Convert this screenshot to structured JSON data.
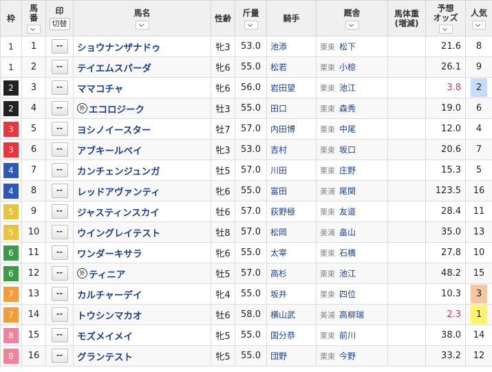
{
  "headers": {
    "waku": "枠",
    "umaban_l1": "馬",
    "umaban_l2": "番",
    "mark": "印",
    "mark_toggle": "切替",
    "name": "馬名",
    "sexage": "性齢",
    "weight": "斤量",
    "jockey": "騎手",
    "stable": "厩舎",
    "body_l1": "馬体重",
    "body_l2": "(増減)",
    "odds_l1": "予想",
    "odds_l2": "オッズ",
    "pop": "人気"
  },
  "colors": {
    "waku_bg": [
      "#ffffff",
      "#ffffff",
      "#222222",
      "#222222",
      "#e8373c",
      "#e8373c",
      "#2f57b6",
      "#2f57b6",
      "#e8c43a",
      "#e8c43a",
      "#3c9b48",
      "#3c9b48",
      "#f29d39",
      "#f29d39",
      "#f0839b",
      "#f0839b"
    ],
    "waku_fg": [
      "#222222",
      "#222222",
      "#ffffff",
      "#ffffff",
      "#ffffff",
      "#ffffff",
      "#ffffff",
      "#ffffff",
      "#ffffff",
      "#ffffff",
      "#ffffff",
      "#ffffff",
      "#ffffff",
      "#ffffff",
      "#ffffff",
      "#ffffff"
    ],
    "pop1": "#fff36b",
    "pop2": "#c5dcfa",
    "pop3": "#f4c7a2"
  },
  "rows": [
    {
      "waku": "1",
      "num": "1",
      "mark": "--",
      "foreign": "",
      "name": "ショウナンザナドゥ",
      "sexage": "牝3",
      "weight": "53.0",
      "jockey": "池添",
      "region": "栗東",
      "trainer": "松下",
      "odds": "21.6",
      "pop": "8"
    },
    {
      "waku": "1",
      "num": "2",
      "mark": "--",
      "foreign": "",
      "name": "テイエムスパーダ",
      "sexage": "牝6",
      "weight": "55.0",
      "jockey": "松若",
      "region": "栗東",
      "trainer": "小椋",
      "odds": "26.1",
      "pop": "9"
    },
    {
      "waku": "2",
      "num": "3",
      "mark": "--",
      "foreign": "",
      "name": "ママコチャ",
      "sexage": "牝6",
      "weight": "56.0",
      "jockey": "岩田望",
      "region": "栗東",
      "trainer": "池江",
      "odds": "3.8",
      "pop": "2"
    },
    {
      "waku": "2",
      "num": "4",
      "mark": "--",
      "foreign": "外",
      "name": "エコロジーク",
      "sexage": "牡3",
      "weight": "55.0",
      "jockey": "田口",
      "region": "栗東",
      "trainer": "森秀",
      "odds": "19.0",
      "pop": "6"
    },
    {
      "waku": "3",
      "num": "5",
      "mark": "--",
      "foreign": "",
      "name": "ヨシノイースター",
      "sexage": "牡7",
      "weight": "57.0",
      "jockey": "内田博",
      "region": "栗東",
      "trainer": "中尾",
      "odds": "12.0",
      "pop": "4"
    },
    {
      "waku": "3",
      "num": "6",
      "mark": "--",
      "foreign": "",
      "name": "アブキールベイ",
      "sexage": "牝3",
      "weight": "53.0",
      "jockey": "吉村",
      "region": "栗東",
      "trainer": "坂口",
      "odds": "20.6",
      "pop": "7"
    },
    {
      "waku": "4",
      "num": "7",
      "mark": "--",
      "foreign": "",
      "name": "カンチェンジュンガ",
      "sexage": "牡5",
      "weight": "57.0",
      "jockey": "川田",
      "region": "栗東",
      "trainer": "庄野",
      "odds": "15.3",
      "pop": "5"
    },
    {
      "waku": "4",
      "num": "8",
      "mark": "--",
      "foreign": "",
      "name": "レッドアヴァンティ",
      "sexage": "牝6",
      "weight": "55.0",
      "jockey": "富田",
      "region": "美浦",
      "trainer": "尾関",
      "odds": "123.5",
      "pop": "16"
    },
    {
      "waku": "5",
      "num": "9",
      "mark": "--",
      "foreign": "",
      "name": "ジャスティンスカイ",
      "sexage": "牡6",
      "weight": "57.0",
      "jockey": "荻野極",
      "region": "栗東",
      "trainer": "友道",
      "odds": "28.4",
      "pop": "11"
    },
    {
      "waku": "5",
      "num": "10",
      "mark": "--",
      "foreign": "",
      "name": "ウイングレイテスト",
      "sexage": "牡8",
      "weight": "57.0",
      "jockey": "松岡",
      "region": "美浦",
      "trainer": "畠山",
      "odds": "35.0",
      "pop": "13"
    },
    {
      "waku": "6",
      "num": "11",
      "mark": "--",
      "foreign": "",
      "name": "ワンダーキサラ",
      "sexage": "牝6",
      "weight": "55.0",
      "jockey": "太宰",
      "region": "栗東",
      "trainer": "石橋",
      "odds": "27.8",
      "pop": "10"
    },
    {
      "waku": "6",
      "num": "12",
      "mark": "--",
      "foreign": "外",
      "name": "ティニア",
      "sexage": "牡5",
      "weight": "57.0",
      "jockey": "高杉",
      "region": "栗東",
      "trainer": "池江",
      "odds": "48.2",
      "pop": "15"
    },
    {
      "waku": "7",
      "num": "13",
      "mark": "--",
      "foreign": "",
      "name": "カルチャーデイ",
      "sexage": "牝4",
      "weight": "55.0",
      "jockey": "坂井",
      "region": "栗東",
      "trainer": "四位",
      "odds": "10.3",
      "pop": "3"
    },
    {
      "waku": "7",
      "num": "14",
      "mark": "--",
      "foreign": "",
      "name": "トウシンマカオ",
      "sexage": "牡6",
      "weight": "58.0",
      "jockey": "横山武",
      "region": "美浦",
      "trainer": "高柳瑞",
      "odds": "2.3",
      "pop": "1"
    },
    {
      "waku": "8",
      "num": "15",
      "mark": "--",
      "foreign": "",
      "name": "モズメイメイ",
      "sexage": "牝5",
      "weight": "55.0",
      "jockey": "国分恭",
      "region": "栗東",
      "trainer": "前川",
      "odds": "38.0",
      "pop": "14"
    },
    {
      "waku": "8",
      "num": "16",
      "mark": "--",
      "foreign": "",
      "name": "グランテスト",
      "sexage": "牝5",
      "weight": "55.0",
      "jockey": "団野",
      "region": "栗東",
      "trainer": "今野",
      "odds": "33.2",
      "pop": "12"
    }
  ]
}
